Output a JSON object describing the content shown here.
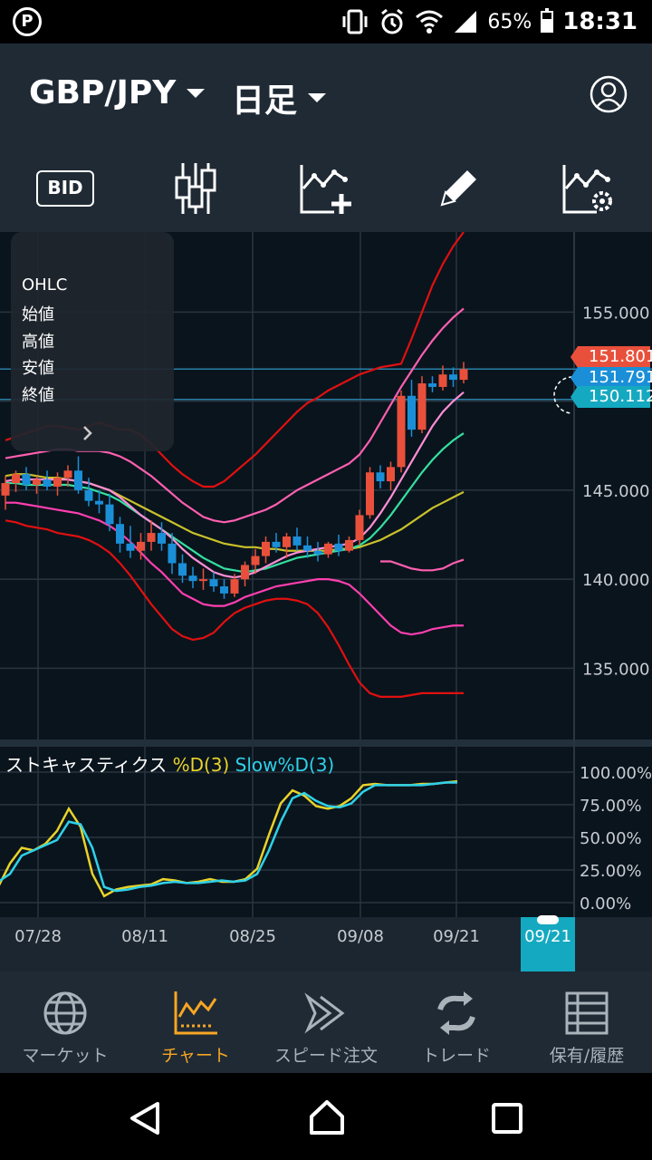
{
  "status_bar": {
    "app_badge": "P",
    "battery_percent": "65%",
    "battery_level": 0.65,
    "time": "18:31",
    "icons": [
      "vibrate-icon",
      "alarm-icon",
      "wifi-icon",
      "signal-icon",
      "battery-icon"
    ]
  },
  "header": {
    "pair": "GBP/JPY",
    "timeframe": "日足",
    "toolbar": {
      "bid_label": "BID",
      "icons": [
        "candlestick-icon",
        "add-indicator-icon",
        "pencil-icon",
        "chart-settings-icon"
      ]
    }
  },
  "ohlc_panel": {
    "title": "OHLC",
    "open": "始値",
    "high": "高値",
    "low": "安値",
    "close": "終値"
  },
  "price_tags": {
    "ask": "151.801",
    "bid": "151.791",
    "line": "150.112"
  },
  "colors": {
    "bg": "#0a141d",
    "panel": "#1f2a35",
    "up_candle": "#e9503b",
    "down_candle": "#1a8fd8",
    "accent": "#f6a623",
    "stoch_d": "#e8d32a",
    "stoch_slow": "#2fd1e8"
  },
  "stochastics": {
    "name": "ストキャスティクス",
    "d_label": "%D(3)",
    "slow_label": "Slow%D(3)"
  },
  "current_date": "09/21",
  "chart_data": [
    {
      "type": "candlestick",
      "title": "GBP/JPY 日足",
      "x_tick_labels": [
        "07/28",
        "08/11",
        "08/25",
        "09/08",
        "09/21"
      ],
      "y_tick_labels": [
        "155.000",
        "145.000",
        "140.000",
        "135.000"
      ],
      "ylim": [
        131.0,
        159.5
      ],
      "grid": true,
      "candles": [
        [
          144.7,
          145.8,
          143.9,
          145.4
        ],
        [
          145.4,
          146.1,
          144.9,
          145.9
        ],
        [
          145.9,
          146.3,
          145.0,
          145.3
        ],
        [
          145.3,
          145.8,
          144.8,
          145.6
        ],
        [
          145.6,
          146.1,
          145.0,
          145.2
        ],
        [
          145.2,
          146.0,
          144.7,
          145.7
        ],
        [
          145.7,
          146.4,
          145.2,
          146.1
        ],
        [
          146.1,
          146.9,
          144.8,
          145.0
        ],
        [
          145.0,
          145.7,
          144.1,
          144.4
        ],
        [
          144.4,
          145.0,
          143.7,
          144.2
        ],
        [
          144.2,
          144.8,
          142.7,
          143.1
        ],
        [
          143.1,
          143.5,
          141.5,
          142.0
        ],
        [
          142.0,
          143.0,
          141.2,
          141.6
        ],
        [
          141.6,
          142.6,
          141.1,
          142.1
        ],
        [
          142.1,
          143.3,
          141.6,
          142.6
        ],
        [
          142.6,
          143.2,
          141.6,
          142.0
        ],
        [
          142.0,
          142.6,
          140.3,
          140.9
        ],
        [
          140.9,
          141.4,
          139.8,
          140.2
        ],
        [
          140.2,
          140.7,
          139.5,
          139.9
        ],
        [
          139.9,
          140.6,
          139.4,
          140.0
        ],
        [
          140.0,
          140.4,
          139.3,
          139.6
        ],
        [
          139.6,
          140.0,
          138.9,
          139.2
        ],
        [
          139.2,
          140.3,
          139.0,
          140.0
        ],
        [
          140.0,
          141.0,
          139.6,
          140.8
        ],
        [
          140.8,
          141.7,
          140.3,
          141.3
        ],
        [
          141.3,
          142.4,
          140.9,
          142.1
        ],
        [
          142.1,
          142.6,
          141.5,
          141.8
        ],
        [
          141.8,
          142.6,
          141.2,
          142.4
        ],
        [
          142.4,
          142.9,
          141.6,
          141.9
        ],
        [
          141.9,
          142.4,
          141.2,
          141.6
        ],
        [
          141.6,
          142.1,
          141.0,
          141.4
        ],
        [
          141.4,
          142.1,
          141.2,
          142.0
        ],
        [
          142.0,
          142.5,
          141.3,
          141.6
        ],
        [
          141.6,
          142.4,
          141.5,
          142.2
        ],
        [
          142.2,
          143.9,
          141.9,
          143.6
        ],
        [
          143.6,
          146.3,
          143.4,
          146.0
        ],
        [
          146.0,
          146.4,
          145.1,
          145.5
        ],
        [
          145.5,
          146.6,
          145.0,
          146.3
        ],
        [
          146.3,
          150.6,
          146.0,
          150.3
        ],
        [
          150.3,
          151.2,
          148.0,
          148.4
        ],
        [
          148.4,
          151.4,
          148.2,
          151.0
        ],
        [
          151.0,
          151.4,
          150.5,
          150.8
        ],
        [
          150.8,
          152.0,
          150.6,
          151.5
        ],
        [
          151.5,
          151.9,
          150.8,
          151.2
        ],
        [
          151.2,
          152.2,
          151.0,
          151.8
        ]
      ],
      "bollinger_upper_3s": [
        147.8,
        148.0,
        148.2,
        148.4,
        148.6,
        148.6,
        148.5,
        148.4,
        148.6,
        148.8,
        148.6,
        148.4,
        148.4,
        148.1,
        147.6,
        147.0,
        146.4,
        145.9,
        145.5,
        145.2,
        145.2,
        145.5,
        146.0,
        146.5,
        147.0,
        147.6,
        148.2,
        148.8,
        149.4,
        149.9,
        150.2,
        150.6,
        150.9,
        151.2,
        151.5,
        151.7,
        151.9,
        152.0,
        152.1,
        153.5,
        155.0,
        156.5,
        157.7,
        158.7,
        159.5
      ],
      "bollinger_upper_2s": [
        146.8,
        146.9,
        147.0,
        147.1,
        147.2,
        147.3,
        147.3,
        147.2,
        147.2,
        147.2,
        147.1,
        146.9,
        146.6,
        146.2,
        145.8,
        145.3,
        144.8,
        144.3,
        143.9,
        143.5,
        143.3,
        143.2,
        143.3,
        143.5,
        143.7,
        143.9,
        144.2,
        144.6,
        145.0,
        145.3,
        145.6,
        145.9,
        146.2,
        146.5,
        147.0,
        147.8,
        148.8,
        149.8,
        150.8,
        151.7,
        152.6,
        153.4,
        154.1,
        154.7,
        155.2
      ],
      "ma_short": [
        145.5,
        145.6,
        145.6,
        145.6,
        145.6,
        145.6,
        145.6,
        145.5,
        145.4,
        145.2,
        145.0,
        144.6,
        144.1,
        143.6,
        143.2,
        142.8,
        142.3,
        141.7,
        141.2,
        140.8,
        140.4,
        140.2,
        140.1,
        140.2,
        140.4,
        140.7,
        141.0,
        141.3,
        141.5,
        141.6,
        141.7,
        141.8,
        141.9,
        142.0,
        142.3,
        142.9,
        143.7,
        144.6,
        145.6,
        146.6,
        147.6,
        148.6,
        149.4,
        150.0,
        150.5
      ],
      "ma_mid": [
        145.4,
        145.4,
        145.3,
        145.3,
        145.3,
        145.3,
        145.3,
        145.2,
        145.1,
        144.9,
        144.7,
        144.4,
        144.0,
        143.6,
        143.2,
        142.8,
        142.4,
        142.0,
        141.6,
        141.2,
        140.9,
        140.6,
        140.5,
        140.4,
        140.5,
        140.6,
        140.8,
        141.0,
        141.2,
        141.3,
        141.4,
        141.5,
        141.6,
        141.7,
        141.9,
        142.3,
        142.9,
        143.6,
        144.4,
        145.2,
        146.0,
        146.7,
        147.3,
        147.8,
        148.2
      ],
      "ma_long": [
        145.8,
        145.9,
        145.9,
        145.8,
        145.7,
        145.7,
        145.6,
        145.5,
        145.4,
        145.2,
        145.0,
        144.7,
        144.4,
        144.1,
        143.8,
        143.5,
        143.2,
        142.9,
        142.6,
        142.4,
        142.2,
        142.0,
        141.9,
        141.8,
        141.8,
        141.7,
        141.7,
        141.6,
        141.6,
        141.6,
        141.6,
        141.6,
        141.7,
        141.7,
        141.8,
        142.0,
        142.2,
        142.5,
        142.8,
        143.2,
        143.6,
        144.0,
        144.3,
        144.6,
        144.9
      ],
      "bollinger_lower_2s": [
        144.3,
        144.3,
        144.2,
        144.1,
        144.0,
        143.9,
        143.8,
        143.7,
        143.5,
        143.3,
        143.0,
        142.6,
        142.1,
        141.5,
        140.9,
        140.4,
        139.8,
        139.2,
        138.9,
        138.6,
        138.5,
        138.5,
        138.7,
        139.0,
        139.2,
        139.4,
        139.6,
        139.7,
        139.8,
        139.9,
        140.0,
        140.0,
        139.9,
        139.7,
        139.2,
        138.6,
        138.0,
        137.4,
        137.0,
        136.9,
        137.0,
        137.2,
        137.3,
        137.4,
        137.4
      ],
      "bollinger_lower_3s": [
        143.3,
        143.2,
        143.0,
        142.9,
        142.8,
        142.6,
        142.5,
        142.4,
        142.2,
        141.9,
        141.5,
        140.9,
        140.2,
        139.4,
        138.6,
        137.9,
        137.2,
        136.8,
        136.6,
        136.7,
        137.0,
        137.6,
        138.1,
        138.4,
        138.6,
        138.8,
        138.9,
        138.9,
        138.8,
        138.6,
        138.1,
        137.3,
        136.3,
        135.2,
        134.2,
        133.6,
        133.4,
        133.4,
        133.4,
        133.5,
        133.6,
        133.6,
        133.6,
        133.6,
        133.6
      ],
      "mid_band_right": [
        141.0,
        141.0,
        140.8,
        140.6,
        140.5,
        140.5,
        140.6,
        140.9,
        141.1
      ],
      "current_price_lines": [
        151.8,
        150.1
      ]
    },
    {
      "type": "line",
      "title": "ストキャスティクス",
      "y_tick_labels": [
        "100.00%",
        "75.00%",
        "50.00%",
        "25.00%",
        "0.00%"
      ],
      "ylim": [
        0,
        100
      ],
      "series": [
        {
          "name": "%D(3)",
          "values": [
            12,
            30,
            42,
            40,
            45,
            55,
            72,
            58,
            22,
            5,
            10,
            12,
            13,
            14,
            18,
            17,
            15,
            16,
            18,
            16,
            16,
            18,
            26,
            52,
            76,
            86,
            82,
            74,
            72,
            74,
            80,
            90,
            91,
            90,
            90,
            90,
            91,
            91,
            92,
            93
          ]
        },
        {
          "name": "Slow%D(3)",
          "values": [
            16,
            22,
            36,
            40,
            44,
            48,
            62,
            60,
            42,
            12,
            9,
            10,
            12,
            13,
            15,
            16,
            15,
            15,
            16,
            17,
            16,
            17,
            22,
            40,
            62,
            80,
            84,
            78,
            74,
            73,
            76,
            85,
            90,
            90,
            90,
            90,
            90,
            91,
            92,
            92
          ]
        }
      ]
    }
  ]
}
